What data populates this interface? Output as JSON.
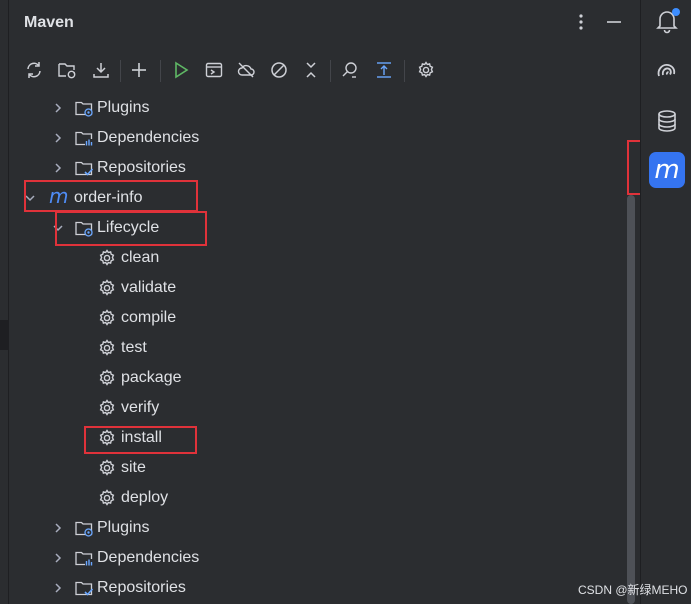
{
  "panel": {
    "title": "Maven"
  },
  "tree": {
    "rows": [
      {
        "label": "Plugins",
        "icon": "folder-plugins-icon",
        "expanded": false
      },
      {
        "label": "Dependencies",
        "icon": "folder-dependencies-icon",
        "expanded": false
      },
      {
        "label": "Repositories",
        "icon": "folder-repositories-icon",
        "expanded": false
      },
      {
        "label": "order-info",
        "icon": "maven-module-icon",
        "expanded": true
      },
      {
        "label": "Lifecycle",
        "icon": "folder-lifecycle-icon",
        "expanded": true
      },
      {
        "label": "clean",
        "icon": "gear-icon"
      },
      {
        "label": "validate",
        "icon": "gear-icon"
      },
      {
        "label": "compile",
        "icon": "gear-icon"
      },
      {
        "label": "test",
        "icon": "gear-icon"
      },
      {
        "label": "package",
        "icon": "gear-icon"
      },
      {
        "label": "verify",
        "icon": "gear-icon"
      },
      {
        "label": "install",
        "icon": "gear-icon"
      },
      {
        "label": "site",
        "icon": "gear-icon"
      },
      {
        "label": "deploy",
        "icon": "gear-icon"
      },
      {
        "label": "Plugins",
        "icon": "folder-plugins-icon",
        "expanded": false
      },
      {
        "label": "Dependencies",
        "icon": "folder-dependencies-icon",
        "expanded": false
      },
      {
        "label": "Repositories",
        "icon": "folder-repositories-icon",
        "expanded": false
      }
    ]
  },
  "sidebar": {
    "maven_glyph": "m"
  },
  "watermark": "CSDN @新绿MEHO",
  "colors": {
    "accent": "#3574f0",
    "highlight": "#e0323a",
    "run": "#5fb865",
    "background": "#2b2d30"
  }
}
